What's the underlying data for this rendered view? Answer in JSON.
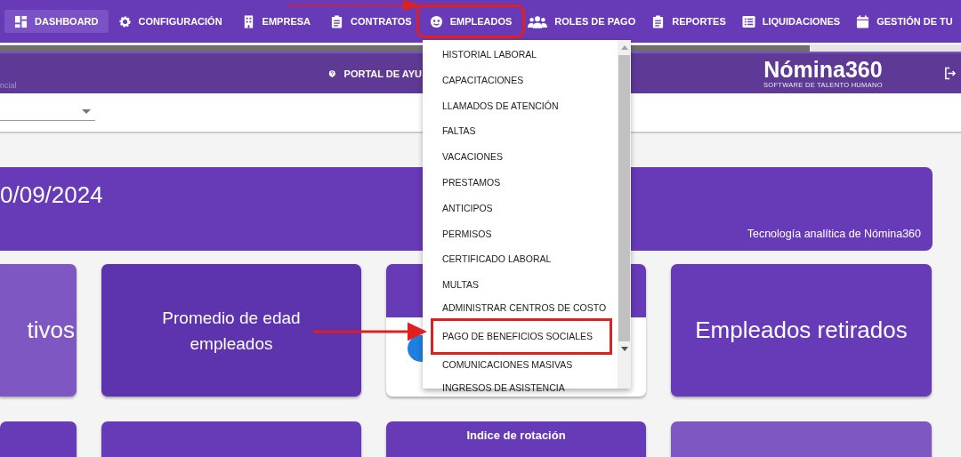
{
  "nav": {
    "items": [
      {
        "label": "DASHBOARD",
        "selected": true,
        "highlighted": false
      },
      {
        "label": "CONFIGURACIÓN",
        "selected": false,
        "highlighted": false
      },
      {
        "label": "EMPRESA",
        "selected": false,
        "highlighted": false
      },
      {
        "label": "CONTRATOS",
        "selected": false,
        "highlighted": false
      },
      {
        "label": "EMPLEADOS",
        "selected": false,
        "highlighted": true
      },
      {
        "label": "ROLES DE PAGO",
        "selected": false,
        "highlighted": false
      },
      {
        "label": "REPORTES",
        "selected": false,
        "highlighted": false
      },
      {
        "label": "LIQUIDACIONES",
        "selected": false,
        "highlighted": false
      },
      {
        "label": "GESTIÓN DE TU",
        "selected": false,
        "highlighted": false
      }
    ]
  },
  "header": {
    "subtitle": "ncial",
    "help_link": "PORTAL DE AYU",
    "logo": {
      "name": "Nómina360",
      "tagline": "SOFTWARE DE TALENTO HUMANO"
    }
  },
  "dropdown_menu": {
    "items": [
      {
        "label": "HISTORIAL LABORAL",
        "highlighted": false
      },
      {
        "label": "CAPACITACIONES",
        "highlighted": false
      },
      {
        "label": "LLAMADOS DE ATENCIÓN",
        "highlighted": false
      },
      {
        "label": "FALTAS",
        "highlighted": false
      },
      {
        "label": "VACACIONES",
        "highlighted": false
      },
      {
        "label": "PRESTAMOS",
        "highlighted": false
      },
      {
        "label": "ANTICIPOS",
        "highlighted": false
      },
      {
        "label": "PERMISOS",
        "highlighted": false
      },
      {
        "label": "CERTIFICADO LABORAL",
        "highlighted": false
      },
      {
        "label": "MULTAS",
        "highlighted": false
      },
      {
        "label": "ADMINISTRAR CENTROS DE COSTO",
        "highlighted": false
      },
      {
        "label": "PAGO DE BENEFICIOS SOCIALES",
        "highlighted": true
      },
      {
        "label": "COMUNICACIONES MASIVAS",
        "highlighted": false
      },
      {
        "label": "INGRESOS DE ASISTENCIA",
        "highlighted": false
      }
    ]
  },
  "banner": {
    "date": "0/09/2024",
    "caption": "Tecnología analítica de Nómina360"
  },
  "cards": [
    {
      "kind": "light",
      "title": "tivos"
    },
    {
      "kind": "dark",
      "title": "Promedio de edad empleados"
    },
    {
      "kind": "chart"
    },
    {
      "kind": "plain",
      "title": "Empleados retirados"
    },
    {
      "kind": "plain"
    },
    {
      "kind": "plain"
    },
    {
      "kind": "plain",
      "title": "Indice de rotación"
    },
    {
      "kind": "light"
    }
  ]
}
